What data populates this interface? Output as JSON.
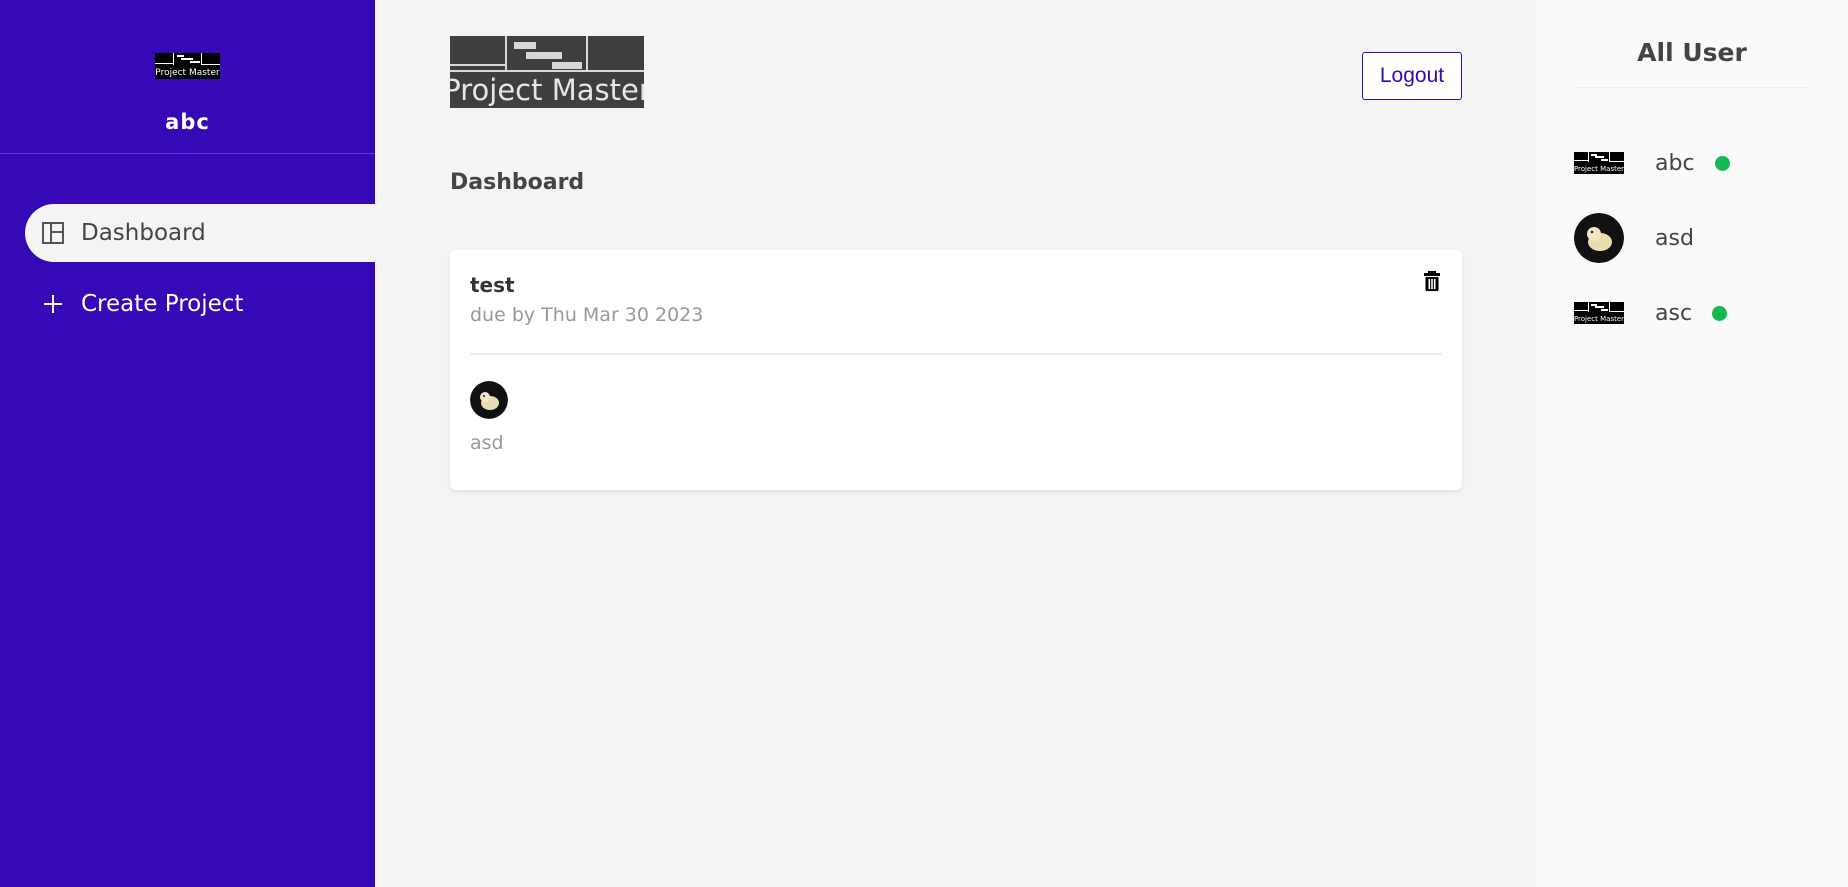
{
  "brand": {
    "logo_text": "Project Master"
  },
  "sidebar": {
    "username": "abc",
    "items": [
      {
        "label": "Dashboard",
        "icon": "dashboard-icon",
        "active": true
      },
      {
        "label": "Create Project",
        "icon": "plus-icon",
        "active": false
      }
    ]
  },
  "header": {
    "logout_label": "Logout"
  },
  "main": {
    "title": "Dashboard",
    "projects": [
      {
        "title": "test",
        "due": "due by Thu Mar 30 2023",
        "assignees": [
          {
            "name": "asd",
            "avatar": "photo"
          }
        ]
      }
    ]
  },
  "user_panel": {
    "title": "All User",
    "users": [
      {
        "name": "abc",
        "avatar": "logo",
        "online": true
      },
      {
        "name": "asd",
        "avatar": "photo",
        "online": false
      },
      {
        "name": "asc",
        "avatar": "logo",
        "online": true
      }
    ]
  },
  "colors": {
    "sidebar": "#3609b6",
    "background": "#f4f4f4",
    "online": "#14b854"
  }
}
